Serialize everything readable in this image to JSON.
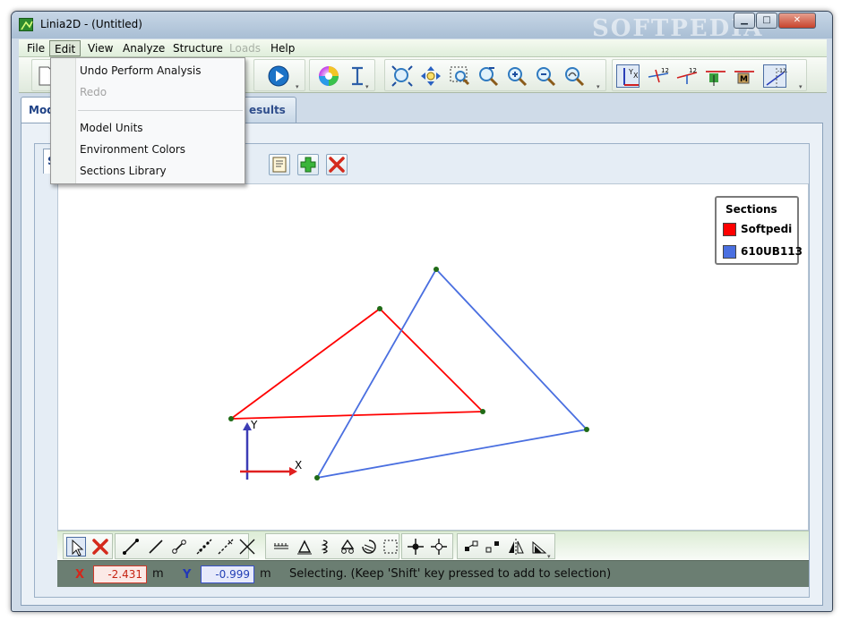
{
  "window": {
    "title": "Linia2D - (Untitled)"
  },
  "menubar": {
    "items": [
      {
        "label": "File"
      },
      {
        "label": "Edit"
      },
      {
        "label": "View"
      },
      {
        "label": "Analyze"
      },
      {
        "label": "Structure"
      },
      {
        "label": "Loads"
      },
      {
        "label": "Help"
      }
    ]
  },
  "edit_menu": {
    "undo": "Undo Perform Analysis",
    "redo": "Redo",
    "model_units": "Model Units",
    "environment_colors": "Environment Colors",
    "sections_library": "Sections Library"
  },
  "tabs": {
    "model_partial": "Mod",
    "results_partial": "esults",
    "structure_partial": "St"
  },
  "legend": {
    "title": "Sections",
    "items": [
      {
        "label": "Softpedi",
        "color": "#ff0000"
      },
      {
        "label": "610UB113",
        "color": "#4a6fe0"
      }
    ]
  },
  "axes": {
    "x_label": "X",
    "y_label": "Y"
  },
  "status": {
    "x_label": "X",
    "x_value": "-2.431",
    "x_unit": "m",
    "y_label": "Y",
    "y_value": "-0.999",
    "y_unit": "m",
    "message": "Selecting. (Keep 'Shift' key pressed to add to selection)"
  },
  "watermark_text": "SOFTPEDIA",
  "colors": {
    "red_section": "#ff0000",
    "blue_section": "#4a6fe0",
    "node": "#1f6b16",
    "axis_y": "#3d3db5",
    "axis_x": "#e02020"
  }
}
